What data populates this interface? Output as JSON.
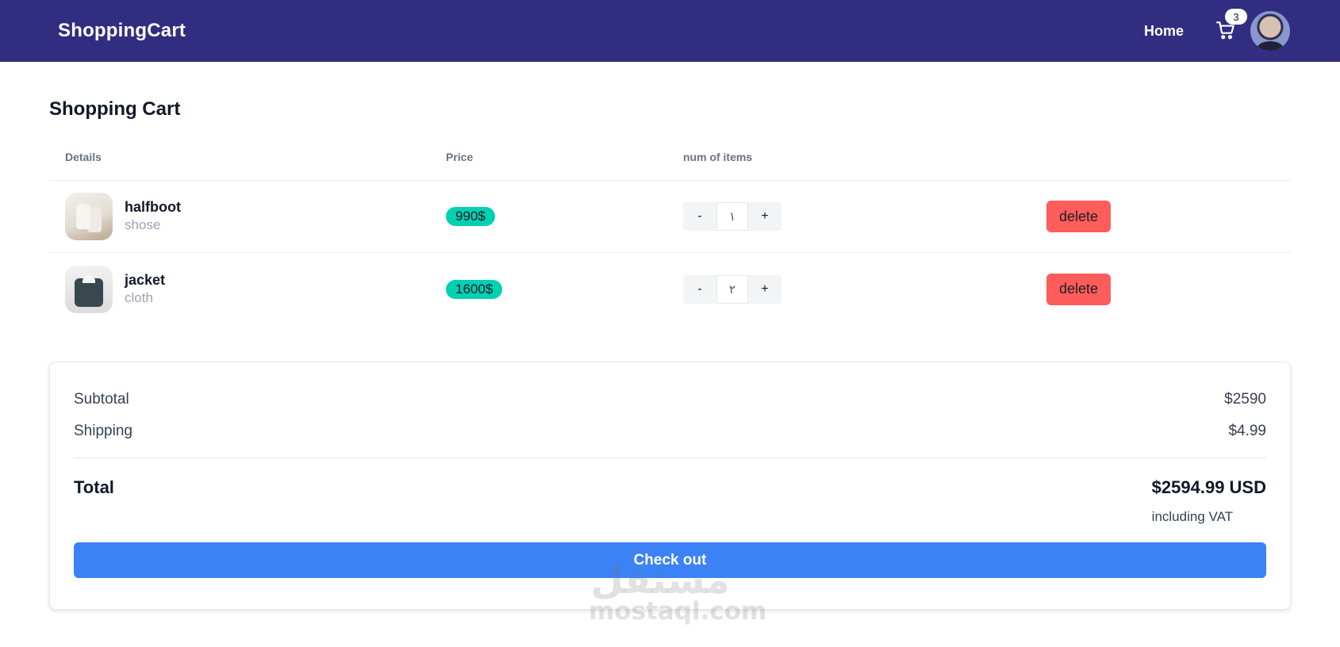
{
  "navbar": {
    "brand": "ShoppingCart",
    "home_label": "Home",
    "cart_count": "3",
    "cart_icon": "cart-icon",
    "avatar_icon": "user-avatar"
  },
  "page": {
    "title": "Shopping Cart"
  },
  "table": {
    "headers": {
      "details": "Details",
      "price": "Price",
      "qty": "num of items"
    },
    "rows": [
      {
        "name": "halfboot",
        "category": "shose",
        "price": "990$",
        "qty": "١",
        "minus_label": "-",
        "plus_label": "+",
        "delete_label": "delete",
        "thumb_icon": "boot-image"
      },
      {
        "name": "jacket",
        "category": "cloth",
        "price": "1600$",
        "qty": "٢",
        "minus_label": "-",
        "plus_label": "+",
        "delete_label": "delete",
        "thumb_icon": "jacket-image"
      }
    ]
  },
  "summary": {
    "subtotal_label": "Subtotal",
    "subtotal_value": "$2590",
    "shipping_label": "Shipping",
    "shipping_value": "$4.99",
    "total_label": "Total",
    "total_value": "$2594.99 USD",
    "vat_note": "including VAT",
    "checkout_label": "Check out"
  },
  "watermark": {
    "arabic": "مستقل",
    "latin": "mostaql.com"
  },
  "colors": {
    "navbar_bg": "#312e81",
    "price_badge": "#00d1b2",
    "delete_button": "#ff5c5c",
    "checkout_button": "#3b82f6"
  }
}
